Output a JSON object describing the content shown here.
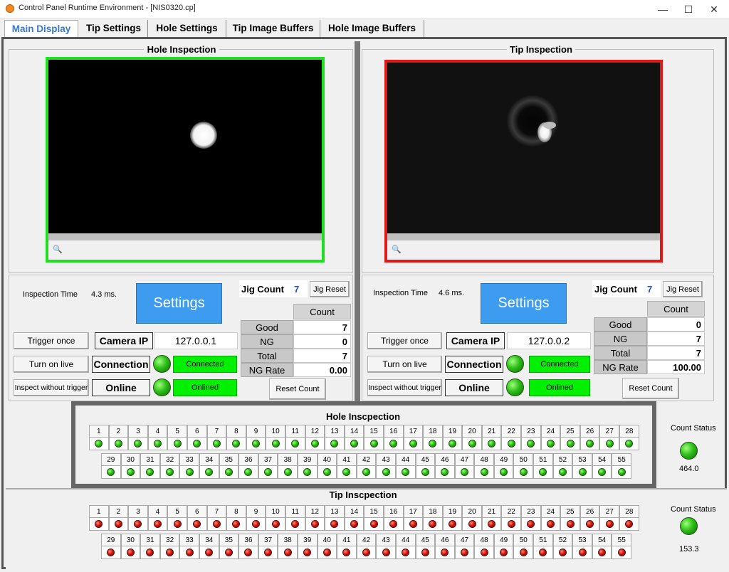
{
  "window": {
    "title": "Control Panel Runtime Environment - [NIS0320.cp]",
    "min": "—",
    "max": "☐",
    "close": "✕"
  },
  "tabs": [
    {
      "label": "Main Display"
    },
    {
      "label": "Tip Settings"
    },
    {
      "label": "Hole Settings"
    },
    {
      "label": "Tip Image Buffers"
    },
    {
      "label": "Hole Image Buffers"
    }
  ],
  "hole": {
    "title": "Hole Inspection",
    "inspection_time_label": "Inspection Time",
    "inspection_time": "4.3 ms.",
    "settings": "Settings",
    "jig_count_label": "Jig Count",
    "jig_count": "7",
    "jig_reset": "Jig Reset",
    "count_header": "Count",
    "good_label": "Good",
    "good": "7",
    "ng_label": "NG",
    "ng": "0",
    "total_label": "Total",
    "total": "7",
    "ngrate_label": "NG Rate",
    "ngrate": "0.00",
    "reset_count": "Reset Count",
    "trigger_once": "Trigger once",
    "turn_on_live": "Turn on live",
    "inspect_without_trigger": "Inspect without trigger",
    "camera_ip_label": "Camera IP",
    "camera_ip": "127.0.0.1",
    "connection_label": "Connection",
    "connection_status": "Connected",
    "online_label": "Online",
    "online_status": "Onlined",
    "frame_color": "#22dd22"
  },
  "tip": {
    "title": "Tip Inspection",
    "inspection_time_label": "Inspection Time",
    "inspection_time": "4.6 ms.",
    "settings": "Settings",
    "jig_count_label": "Jig Count",
    "jig_count": "7",
    "jig_reset": "Jig Reset",
    "count_header": "Count",
    "good_label": "Good",
    "good": "0",
    "ng_label": "NG",
    "ng": "7",
    "total_label": "Total",
    "total": "7",
    "ngrate_label": "NG Rate",
    "ngrate": "100.00",
    "reset_count": "Reset Count",
    "trigger_once": "Trigger once",
    "turn_on_live": "Turn on live",
    "inspect_without_trigger": "Inspect without trigger",
    "camera_ip_label": "Camera IP",
    "camera_ip": "127.0.0.2",
    "connection_label": "Connection",
    "connection_status": "Connected",
    "online_label": "Online",
    "online_status": "Onlined",
    "frame_color": "#e01818"
  },
  "hole_grid": {
    "title": "Hole Inscpection",
    "count_status_label": "Count Status",
    "count_status_value": "464.0",
    "indicator_color": "green",
    "row1": [
      "1",
      "2",
      "3",
      "4",
      "5",
      "6",
      "7",
      "8",
      "9",
      "10",
      "11",
      "12",
      "13",
      "14",
      "15",
      "16",
      "17",
      "18",
      "19",
      "20",
      "21",
      "22",
      "23",
      "24",
      "25",
      "26",
      "27",
      "28"
    ],
    "row2": [
      "29",
      "30",
      "31",
      "32",
      "33",
      "34",
      "35",
      "36",
      "37",
      "38",
      "39",
      "40",
      "41",
      "42",
      "43",
      "44",
      "45",
      "46",
      "47",
      "48",
      "49",
      "50",
      "51",
      "52",
      "53",
      "54",
      "55"
    ]
  },
  "tip_grid": {
    "title": "Tip Inscpection",
    "count_status_label": "Count Status",
    "count_status_value": "153.3",
    "indicator_color": "red",
    "row1": [
      "1",
      "2",
      "3",
      "4",
      "5",
      "6",
      "7",
      "8",
      "9",
      "10",
      "11",
      "12",
      "13",
      "14",
      "15",
      "16",
      "17",
      "18",
      "19",
      "20",
      "21",
      "22",
      "23",
      "24",
      "25",
      "26",
      "27",
      "28"
    ],
    "row2": [
      "29",
      "30",
      "31",
      "32",
      "33",
      "34",
      "35",
      "36",
      "37",
      "38",
      "39",
      "40",
      "41",
      "42",
      "43",
      "44",
      "45",
      "46",
      "47",
      "48",
      "49",
      "50",
      "51",
      "52",
      "53",
      "54",
      "55"
    ]
  }
}
